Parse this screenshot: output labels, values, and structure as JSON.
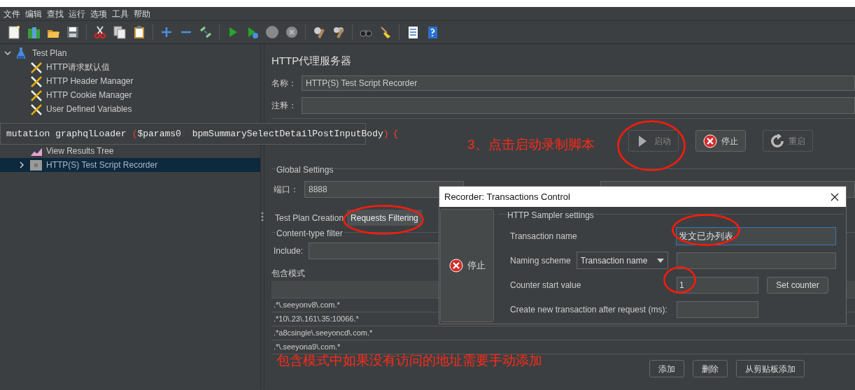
{
  "menu": [
    "文件",
    "编辑",
    "查找",
    "运行",
    "选项",
    "工具",
    "帮助"
  ],
  "tree": [
    {
      "label": "Test Plan",
      "kind": "flask",
      "expanded": true,
      "selected": false,
      "children": [
        {
          "label": "HTTP请求默认值",
          "kind": "tools",
          "selected": false
        },
        {
          "label": "HTTP Header Manager",
          "kind": "tools",
          "selected": false
        },
        {
          "label": "HTTP Cookie Manager",
          "kind": "tools",
          "selected": false
        },
        {
          "label": "User Defined Variables",
          "kind": "tools",
          "selected": false
        },
        {
          "label": "View Results Tree",
          "kind": "graph",
          "selected": false
        },
        {
          "label": "HTTP(S) Test Script Recorder",
          "kind": "recorder",
          "expanded": false,
          "selected": true
        }
      ]
    }
  ],
  "tooltip": {
    "segments": [
      {
        "text": "mutation graphqlLoader",
        "kind": "plain"
      },
      {
        "text": "(",
        "kind": "punct"
      },
      {
        "text": "$params0",
        "kind": "plain"
      },
      {
        "text": ":",
        "kind": "dim"
      },
      {
        "text": "bpmSummarySelectDetailPostInputBody",
        "kind": "plain"
      },
      {
        "text": ")",
        "kind": "punct"
      },
      {
        "text": "{",
        "kind": "punct"
      }
    ]
  },
  "panel": {
    "title": "HTTP代理服务器",
    "name_label": "名称：",
    "name_value": "HTTP(S) Test Script Recorder",
    "comment_label": "注释：",
    "state_buttons": [
      {
        "label": "启动",
        "kind": "start",
        "disabled": true
      },
      {
        "label": "停止",
        "kind": "stop",
        "disabled": false
      },
      {
        "label": "重启",
        "kind": "restart",
        "disabled": true
      }
    ],
    "global_settings": {
      "title": "Global Settings",
      "port_label": "端口：",
      "port_value": "8888"
    },
    "tabs": [
      {
        "label": "Test Plan Creation",
        "selected": false
      },
      {
        "label": "Requests Filtering",
        "selected": true
      }
    ],
    "content_type_filter": {
      "title": "Content-type filter",
      "include_label": "Include:"
    },
    "include_patterns": {
      "title": "包含模式",
      "rows": [
        ".*\\.seeyonv8\\.com.*",
        ".*10\\.23\\.161\\.35:10066.*",
        ".*a8csingle\\.seeyoncd\\.com.*",
        ".*\\.seeyona9\\.com.*"
      ]
    },
    "buttons": [
      "添加",
      "删除",
      "从剪贴板添加"
    ]
  },
  "dialog": {
    "title": "Recorder: Transactions Control",
    "stop_button": "停止",
    "group_title": "HTTP Sampler settings",
    "transaction_name_label": "Transaction name",
    "transaction_name": "发文已办列表",
    "naming_scheme_label": "Naming scheme",
    "naming_scheme": "Transaction name",
    "counter_label": "Counter start value",
    "counter_value": "1",
    "set_counter": "Set counter",
    "create_label": "Create new transaction after request (ms):"
  },
  "annotations": [
    "3、点击启动录制脚本",
    "包含模式中如果没有访问的地址需要手动添加"
  ]
}
